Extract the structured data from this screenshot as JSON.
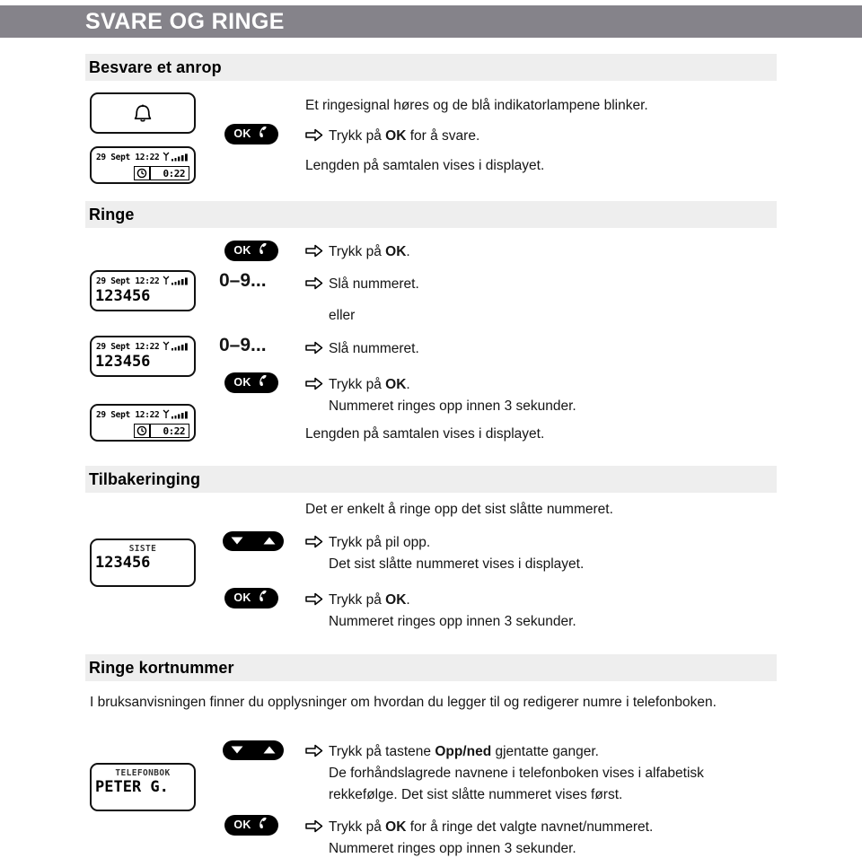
{
  "header": {
    "title": "SVARE OG RINGE"
  },
  "sections": {
    "answer": {
      "heading": "Besvare et anrop",
      "lines": {
        "l1": "Et ringesignal høres og de blå indikatorlampene blinker.",
        "l2_pre": "Trykk på ",
        "l2_bold": "OK",
        "l2_post": " for å svare.",
        "l3": "Lengden på samtalen vises i displayet."
      },
      "buttons": {
        "ok": "OK"
      },
      "displays": {
        "ringing": {
          "icon": "bell-icon"
        },
        "intalk": {
          "status": "29 Sept 12:22",
          "timer": "0:22",
          "clock_icon": "clock-icon",
          "signal_icon": "signal-bars-icon"
        }
      }
    },
    "call": {
      "heading": "Ringe",
      "buttons": {
        "ok": "OK",
        "digits": "0–9..."
      },
      "lines": {
        "l1_pre": "Trykk på ",
        "l1_bold": "OK",
        "l1_post": ".",
        "l2": "Slå nummeret.",
        "l3": "eller",
        "l4": "Slå nummeret.",
        "l5_pre": "Trykk på ",
        "l5_bold": "OK",
        "l5_post": ".",
        "l6": "Nummeret ringes opp innen 3 sekunder.",
        "l7": "Lengden på samtalen vises i displayet."
      },
      "displays": {
        "dial1": {
          "status": "29 Sept 12:22",
          "number": "123456",
          "signal_icon": "signal-bars-icon"
        },
        "dial2": {
          "status": "29 Sept 12:22",
          "number": "123456",
          "signal_icon": "signal-bars-icon"
        },
        "intalk": {
          "status": "29 Sept 12:22",
          "timer": "0:22",
          "clock_icon": "clock-icon",
          "signal_icon": "signal-bars-icon"
        }
      }
    },
    "redial": {
      "heading": "Tilbakeringing",
      "lines": {
        "l1": "Det er enkelt å ringe opp det sist slåtte nummeret.",
        "l2": "Trykk på pil opp.",
        "l3": "Det sist slåtte nummeret vises i displayet.",
        "l4_pre": "Trykk på ",
        "l4_bold": "OK",
        "l4_post": ".",
        "l5": "Nummeret ringes opp innen 3 sekunder."
      },
      "buttons": {
        "ok": "OK",
        "updown": "up-down-arrows"
      },
      "displays": {
        "last": {
          "caption": "SISTE",
          "number": "123456"
        }
      }
    },
    "speeddial": {
      "heading": "Ringe kortnummer",
      "intro": "I bruksanvisningen finner du opplysninger om hvordan du legger til og redigerer numre i telefonboken.",
      "lines": {
        "l1_pre": "Trykk på tastene ",
        "l1_bold": "Opp/ned",
        "l1_post": " gjentatte ganger.",
        "l2": "De forhåndslagrede navnene i telefonboken vises i alfabetisk",
        "l3": "rekkefølge. Det sist slåtte nummeret vises først.",
        "l4_pre": "Trykk på ",
        "l4_bold": "OK",
        "l4_post": " for å ringe det valgte navnet/nummeret.",
        "l5": "Nummeret ringes opp innen 3 sekunder."
      },
      "buttons": {
        "ok": "OK",
        "updown": "up-down-arrows"
      },
      "displays": {
        "phonebook": {
          "caption": "TELEFONBOK",
          "number": "PETER G."
        }
      }
    }
  },
  "colors": {
    "titlebar_bg": "#85838a",
    "band_bg": "#eeeeee",
    "button_bg": "#000000",
    "text": "#151515"
  }
}
